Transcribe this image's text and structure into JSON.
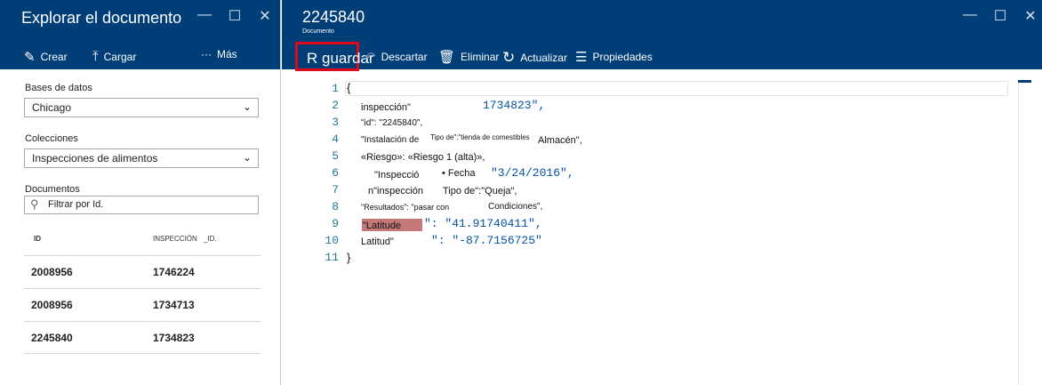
{
  "left_blade": {
    "title": "Explorar el documento",
    "window_controls": [
      "—",
      "☐",
      "✕"
    ],
    "commands": {
      "create": "Crear",
      "upload": "Cargar",
      "more_icon": "···",
      "more": "Más"
    },
    "databases": {
      "label": "Bases de datos",
      "value": "Chicago"
    },
    "collections": {
      "label": "Colecciones",
      "value": "Inspecciones de alimentos"
    },
    "documents": {
      "label": "Documentos",
      "filter_placeholder": "Filtrar por Id."
    },
    "table": {
      "headers": [
        "ID",
        "INSPECCIÓN",
        "_ID."
      ],
      "rows": [
        [
          "2008956",
          "1746224"
        ],
        [
          "2008956",
          "1734713"
        ],
        [
          "2245840",
          "1734823"
        ]
      ]
    }
  },
  "right_blade": {
    "title": "2245840",
    "subtitle": "Documento",
    "window_controls": [
      "—",
      "☐",
      "✕"
    ],
    "commands": {
      "save": "R guardar",
      "discard": "Descartar",
      "delete": "Eliminar",
      "refresh": "Actualizar",
      "properties": "Propiedades"
    },
    "editor": {
      "line_numbers": [
        "1",
        "2",
        "3",
        "4",
        "5",
        "6",
        "7",
        "8",
        "9",
        "10",
        "11"
      ],
      "lines": {
        "l1": "{",
        "l2a": "inspección\"",
        "l2b": "1734823\",",
        "l3": "\"id\": \"2245840\",",
        "l4a": "\"Instalación de",
        "l4b": "Tipo de\":\"tienda de comestibles",
        "l4c": "Almacén\",",
        "l5": "«Riesgo»: «Riesgo 1 (alta)»,",
        "l6a": "\"Inspecció",
        "l6b": "• Fecha",
        "l6c": "\"3/24/2016\",",
        "l7a": "n\"inspección",
        "l7b": "Tipo de\":\"Queja\",",
        "l8a": "\"Resultados\": \"pasar con",
        "l8b": "Condiciones\",",
        "l9a": "\"Latitude",
        "l9b": "\": \"41.91740411\",",
        "l10a": "Latitud\"",
        "l10b": "\": \"-87.7156725\"",
        "l11": "}"
      }
    }
  }
}
